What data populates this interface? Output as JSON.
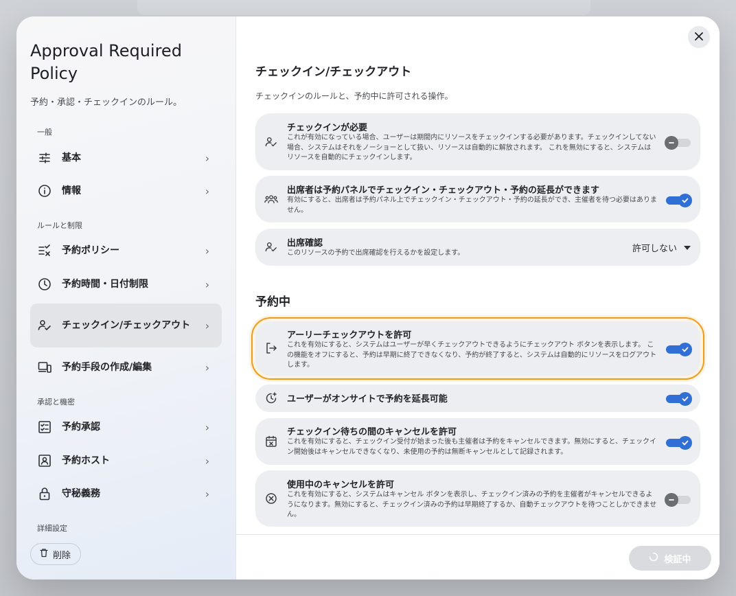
{
  "sidebar": {
    "title": "Approval Required Policy",
    "subtitle": "予約・承認・チェックインのルール。",
    "sections": {
      "general": "一般",
      "rules": "ルールと制限",
      "approval": "承認と機密",
      "advanced": "詳細設定"
    },
    "items": [
      {
        "label": "基本",
        "icon": "sliders-icon"
      },
      {
        "label": "情報",
        "icon": "info-icon"
      },
      {
        "label": "予約ポリシー",
        "icon": "checklist-x-icon"
      },
      {
        "label": "予約時間・日付制限",
        "icon": "clock-icon"
      },
      {
        "label": "チェックイン/チェックアウト",
        "icon": "person-check-icon"
      },
      {
        "label": "予約手段の作成/編集",
        "icon": "devices-icon"
      },
      {
        "label": "予約承認",
        "icon": "approval-icon"
      },
      {
        "label": "予約ホスト",
        "icon": "host-badge-icon"
      },
      {
        "label": "守秘義務",
        "icon": "lock-icon"
      }
    ],
    "delete_label": "削除"
  },
  "main": {
    "section1": {
      "title": "チェックイン/チェックアウト",
      "description": "チェックインのルールと、予約中に許可される操作。",
      "cards": [
        {
          "title": "チェックインが必要",
          "description": "これが有効になっている場合、ユーザーは期間内にリソースをチェックインする必要があります。チェックインしてない場合、システムはそれをノーショーとして扱い、リソースは自動的に解放されます。 これを無効にすると、システムはリソースを自動的にチェックインします。",
          "enabled": false,
          "icon": "person-check-icon"
        },
        {
          "title": "出席者は予約パネルでチェックイン・チェックアウト・予約の延長ができます",
          "description": "有効にすると、出席者は予約パネル上でチェックイン・チェックアウト・予約の延長ができ、主催者を待つ必要はありません。",
          "enabled": true,
          "icon": "group-icon"
        },
        {
          "title": "出席確認",
          "description": "このリソースの予約で出席確認を行えるかを設定します。",
          "select_value": "許可しない",
          "icon": "person-check-icon"
        }
      ]
    },
    "section2": {
      "title": "予約中",
      "cards": [
        {
          "title": "アーリーチェックアウトを許可",
          "description": "これを有効にすると、システムはユーザーが早くチェックアウトできるようにチェックアウト ボタンを表示します。 この機能をオフにすると、予約は早期に終了できなくなり、予約が終了すると、システムは自動的にリソースをログアウトします。",
          "enabled": true,
          "icon": "logout-icon"
        },
        {
          "title": "ユーザーがオンサイトで予約を延長可能",
          "enabled": true,
          "icon": "clock-plus-icon"
        },
        {
          "title": "チェックイン待ちの間のキャンセルを許可",
          "description": "これを有効にすると、チェックイン受付が始まった後も主催者は予約をキャンセルできます。無効にすると、チェックイン開始後はキャンセルできなくなり、未使用の予約は無断キャンセルとして記録されます。",
          "enabled": true,
          "icon": "calendar-x-icon"
        },
        {
          "title": "使用中のキャンセルを許可",
          "description": "これを有効にすると、システムはキャンセル ボタンを表示し、チェックイン済みの予約を主催者がキャンセルできるようになります。無効にすると、チェックイン済みの予約は早期終了するか、自動チェックアウトを待つことしかできません。",
          "enabled": false,
          "icon": "circle-x-icon"
        }
      ]
    },
    "footer": {
      "verify_label": "検証中"
    }
  },
  "colors": {
    "accent": "#2f6fd6",
    "highlight": "#f29a1a"
  }
}
